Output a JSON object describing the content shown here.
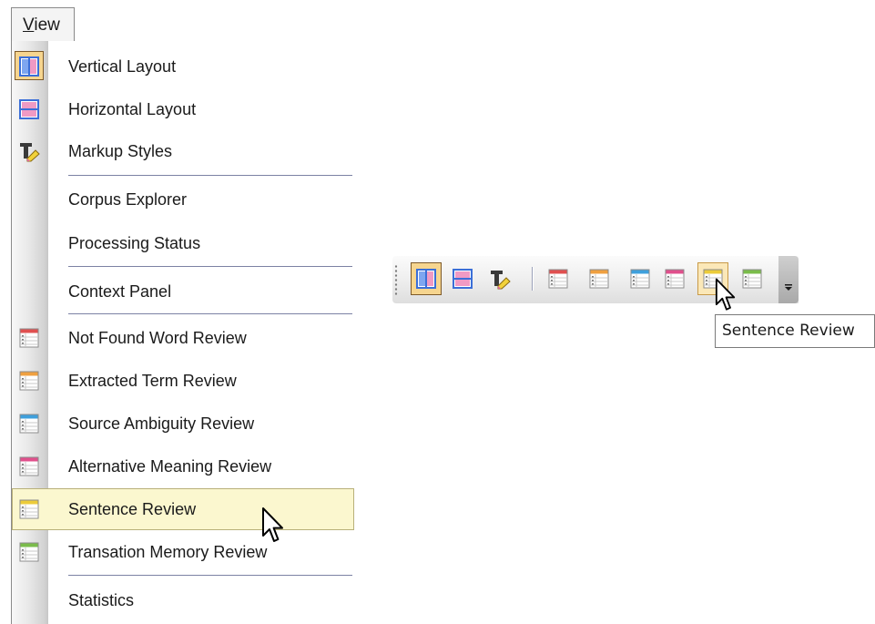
{
  "menu_bar": {
    "view_menu": {
      "label": "View",
      "mnemonic": "V",
      "rest": "iew"
    }
  },
  "view_menu": {
    "items": [
      {
        "id": "vertical-layout",
        "label": "Vertical Layout",
        "icon": "vertical-layout-icon",
        "checked": true
      },
      {
        "id": "horizontal-layout",
        "label": "Horizontal Layout",
        "icon": "horizontal-layout-icon"
      },
      {
        "id": "markup-styles",
        "label": "Markup Styles",
        "icon": "markup-styles-icon"
      },
      {
        "id": "corpus-explorer",
        "label": "Corpus Explorer"
      },
      {
        "id": "processing-status",
        "label": "Processing Status"
      },
      {
        "id": "context-panel",
        "label": "Context Panel"
      },
      {
        "id": "not-found-word-review",
        "label": "Not Found Word Review",
        "icon": "table-icon-red",
        "color": "#e05050"
      },
      {
        "id": "extracted-term-review",
        "label": "Extracted Term Review",
        "icon": "table-icon-orange",
        "color": "#f0a040"
      },
      {
        "id": "source-ambiguity-review",
        "label": "Source Ambiguity Review",
        "icon": "table-icon-blue",
        "color": "#3fa0dc"
      },
      {
        "id": "alternative-meaning-review",
        "label": "Alternative Meaning Review",
        "icon": "table-icon-pink",
        "color": "#e0508c"
      },
      {
        "id": "sentence-review",
        "label": "Sentence Review",
        "icon": "table-icon-yellow",
        "color": "#eccc3a",
        "highlighted": true
      },
      {
        "id": "transation-memory-review",
        "label": "Transation Memory Review",
        "icon": "table-icon-green",
        "color": "#7abc4a"
      },
      {
        "id": "statistics",
        "label": "Statistics"
      }
    ]
  },
  "toolbar": {
    "buttons": [
      {
        "id": "vertical-layout",
        "icon": "vertical-layout-icon",
        "checked": true
      },
      {
        "id": "horizontal-layout",
        "icon": "horizontal-layout-icon"
      },
      {
        "id": "markup-styles",
        "icon": "markup-styles-icon"
      },
      {
        "id": "not-found-word-review",
        "icon": "table-icon-red",
        "color": "#e05050"
      },
      {
        "id": "extracted-term-review",
        "icon": "table-icon-orange",
        "color": "#f0a040"
      },
      {
        "id": "source-ambiguity-review",
        "icon": "table-icon-blue",
        "color": "#3fa0dc"
      },
      {
        "id": "alternative-meaning-review",
        "icon": "table-icon-pink",
        "color": "#e0508c"
      },
      {
        "id": "sentence-review",
        "icon": "table-icon-yellow",
        "color": "#eccc3a",
        "hot": true
      },
      {
        "id": "transation-memory-review",
        "icon": "table-icon-green",
        "color": "#7abc4a"
      }
    ],
    "tooltip": "Sentence Review"
  },
  "colors": {
    "menu_highlight": "#fbf7cf",
    "checked_background": "#f6d58f",
    "separator": "#7c82a4",
    "layout_icon_blue": "#3b6fd8",
    "layout_icon_pink": "#e86aa8"
  }
}
